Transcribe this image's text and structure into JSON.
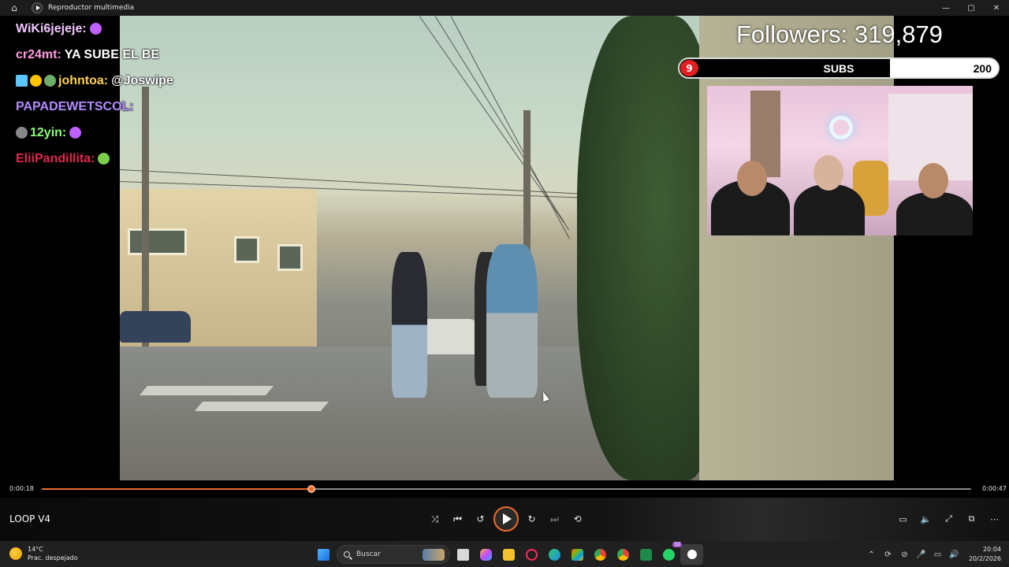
{
  "window": {
    "title": "Reproductor multimedia"
  },
  "chat": [
    {
      "user": "WiKi6jejeje:",
      "user_color": "#f3c6ff",
      "badges": [],
      "message": "",
      "emote": "purple-feather"
    },
    {
      "user": "cr24mt:",
      "user_color": "#ff9de0",
      "badges": [],
      "message": "YA SUBE EL BE",
      "emote": ""
    },
    {
      "user": "johntoa:",
      "user_color": "#ffd04a",
      "badges": [
        "sword-badge",
        "number-1-badge",
        "skull-badge"
      ],
      "message": "@Joswipe",
      "emote": ""
    },
    {
      "user": "PAPADEWETSCOL:",
      "user_color": "#b48cff",
      "badges": [],
      "message": "",
      "emote": ""
    },
    {
      "user": "12yin:",
      "user_color": "#8cff7a",
      "badges": [
        "skull-badge"
      ],
      "message": "",
      "emote": "purple-feather"
    },
    {
      "user": "EliiPandillita:",
      "user_color": "#e0284a",
      "badges": [],
      "message": "",
      "emote": "green-face"
    }
  ],
  "overlay": {
    "followers_text": "Followers: 319,879",
    "subs": {
      "current": "9",
      "label": "SUBS",
      "goal": "200",
      "progress": 0.045
    }
  },
  "player": {
    "current_time": "0:00:18",
    "total_time": "0:00:47",
    "progress": 0.29,
    "song_title": "LOOP V4",
    "accent": "#f06a2a",
    "controls": [
      "shuffle-icon",
      "previous-icon",
      "rewind-10-icon",
      "play-icon",
      "forward-30-icon",
      "next-icon",
      "repeat-off-icon"
    ],
    "right_controls": [
      "subtitles-icon",
      "volume-icon",
      "fullscreen-icon",
      "miniplayer-icon",
      "more-icon"
    ]
  },
  "taskbar": {
    "weather_temp": "14°C",
    "weather_desc": "Prac. despejado",
    "search_placeholder": "Buscar",
    "whatsapp_badge": "32",
    "time": "20:04",
    "date": "20/2/2026"
  }
}
